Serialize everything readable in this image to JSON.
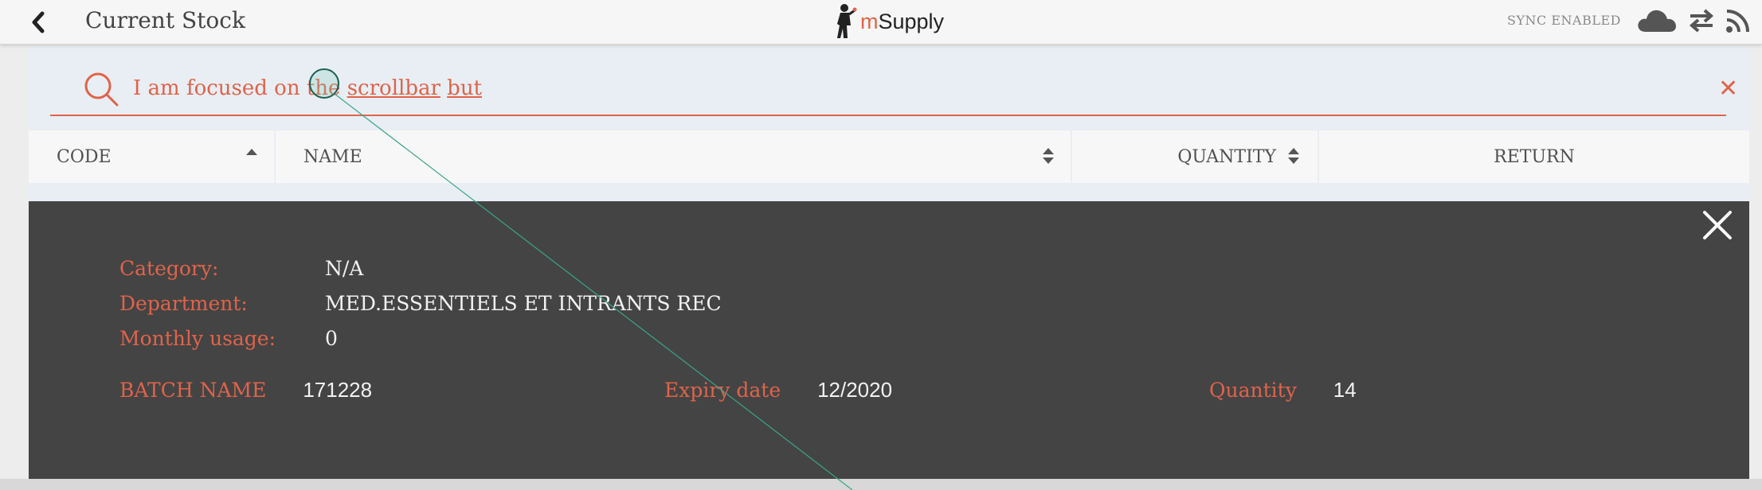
{
  "header": {
    "back_icon": "chevron-left-icon",
    "title": "Current Stock",
    "logo_m": "m",
    "logo_rest": "Supply",
    "sync_status": "SYNC ENABLED",
    "icons": [
      "cloud-icon",
      "swap-arrows-icon",
      "rss-icon"
    ]
  },
  "search": {
    "text_before": "I am focused on th",
    "text_mid": "e ",
    "text_scroll": "scrollbar",
    "text_space": " ",
    "text_but": "but",
    "clear_glyph": "✕"
  },
  "table": {
    "columns": [
      {
        "label": "CODE",
        "sort": "ascending"
      },
      {
        "label": "NAME",
        "sort": "none"
      },
      {
        "label": "QUANTITY",
        "sort": "none"
      },
      {
        "label": "RETURN",
        "sort": ""
      }
    ]
  },
  "detail": {
    "category_label": "Category:",
    "category_value": "N/A",
    "department_label": "Department:",
    "department_value": "MED.ESSENTIELS ET INTRANTS REC",
    "usage_label": "Monthly usage:",
    "usage_value": "0",
    "batch_label": "BATCH NAME",
    "batch_value": "171228",
    "expiry_label": "Expiry date",
    "expiry_value": "12/2020",
    "quantity_label": "Quantity",
    "quantity_value": "14"
  },
  "colors": {
    "accent": "#e0634a",
    "panel_bg": "#444444",
    "header_bg": "#f6f6f6",
    "content_bg": "#e9eef4"
  }
}
